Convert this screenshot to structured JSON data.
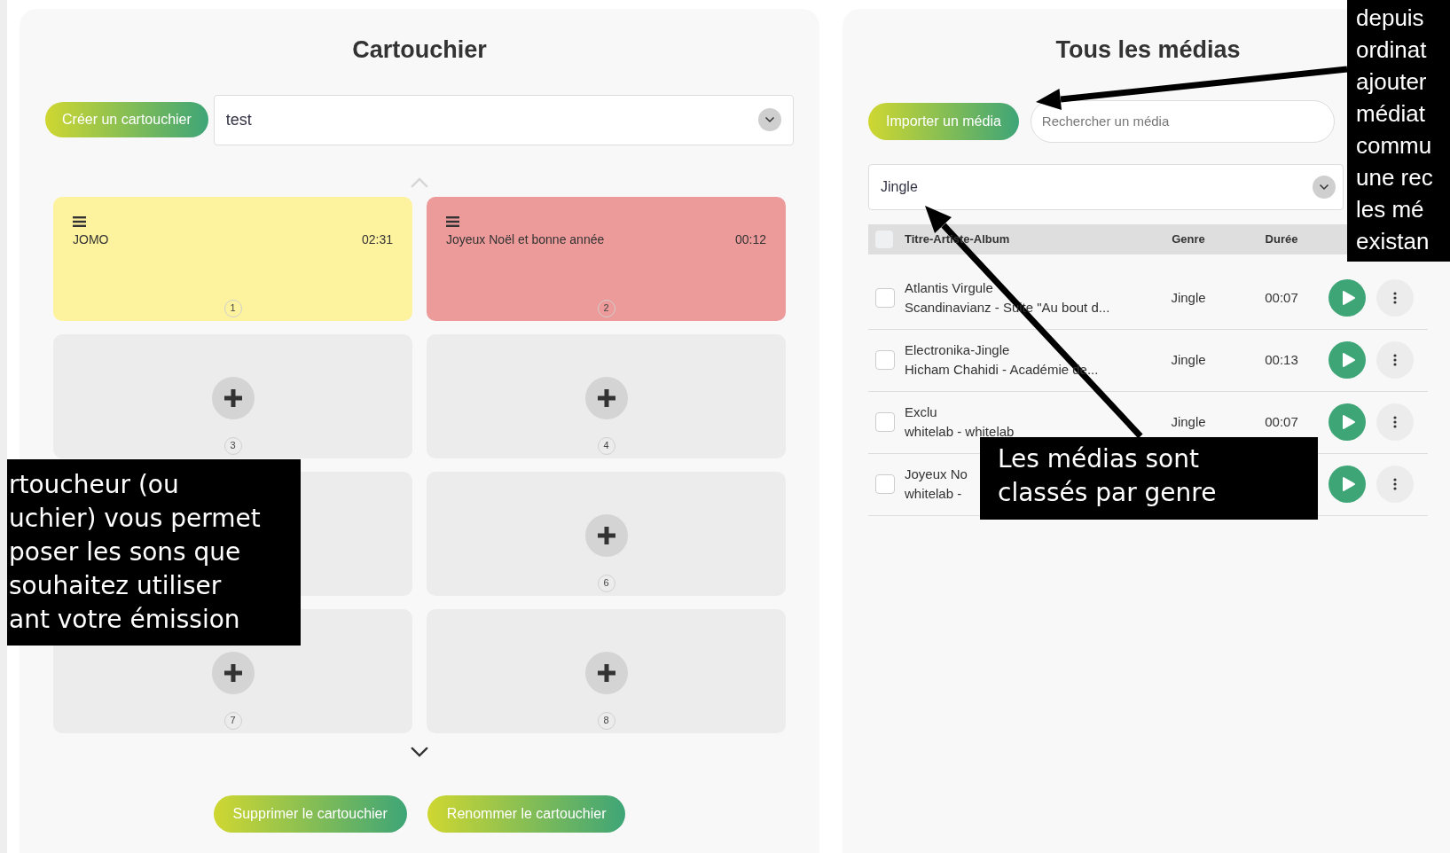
{
  "cartouchier": {
    "title": "Cartouchier",
    "create_button": "Créer un cartouchier",
    "selected_cartouchier": "test",
    "slots": [
      {
        "kind": "media",
        "title": "JOMO",
        "duration": "02:31",
        "number": "1",
        "color": "#fdf29e"
      },
      {
        "kind": "media",
        "title": "Joyeux Noël et bonne année",
        "duration": "00:12",
        "number": "2",
        "color": "#ed9a9a"
      },
      {
        "kind": "empty",
        "number": "3"
      },
      {
        "kind": "empty",
        "number": "4"
      },
      {
        "kind": "blank"
      },
      {
        "kind": "empty",
        "number": "6"
      },
      {
        "kind": "empty",
        "number": "7"
      },
      {
        "kind": "empty",
        "number": "8"
      }
    ],
    "buttons": [
      "Supprimer le cartouchier",
      "Renommer le cartouchier"
    ]
  },
  "medias": {
    "title": "Tous les médias",
    "import_button": "Importer un média",
    "search": {
      "placeholder": "Rechercher un média"
    },
    "genre_filter": "Jingle",
    "table": {
      "select_all": {
        "checked": false
      },
      "columns": [
        "Titre-Artiste-Album",
        "Genre",
        "Durée"
      ],
      "rows": [
        {
          "title": "Atlantis Virgule",
          "subtitle": "Scandinavianz - Suite \"Au bout d...",
          "genre": "Jingle",
          "duration": "00:07",
          "checked": false
        },
        {
          "title": "Electronika-Jingle",
          "subtitle": "Hicham Chahidi - Académie de...",
          "genre": "Jingle",
          "duration": "00:13",
          "checked": false
        },
        {
          "title": "Exclu",
          "subtitle": "whitelab - whitelab",
          "genre": "Jingle",
          "duration": "00:07",
          "checked": false
        },
        {
          "title": "Joyeux No",
          "subtitle": "whitelab -",
          "checked": false
        }
      ]
    }
  },
  "callouts": [
    {
      "kind": "right-edge",
      "lines": [
        "depuis",
        "ordinat",
        "ajouter",
        "médiat",
        "commu",
        "une rec",
        "les mé",
        "existan"
      ]
    },
    {
      "kind": "left-edge",
      "lines": [
        "rtoucheur (ou",
        "uchier) vous permet",
        "poser les sons que",
        "souhaitez utiliser",
        "ant votre émission"
      ]
    },
    {
      "kind": "middle",
      "lines": [
        "Les médias sont",
        "classés par genre"
      ]
    }
  ]
}
